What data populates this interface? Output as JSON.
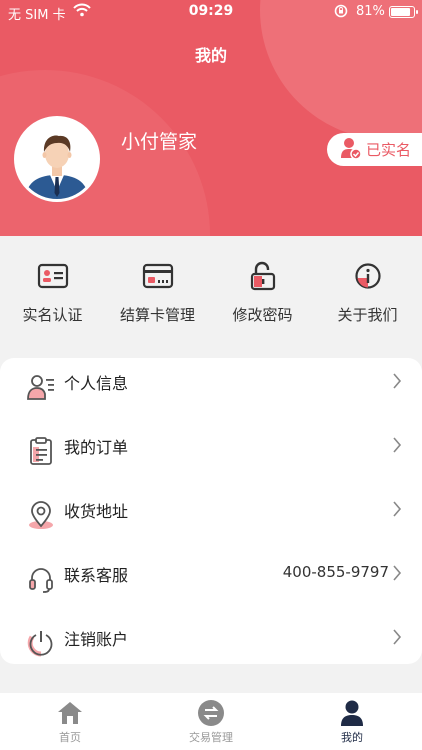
{
  "status_bar": {
    "carrier": "无 SIM 卡",
    "time": "09:29",
    "battery": "81%"
  },
  "nav": {
    "title": "我的"
  },
  "profile": {
    "name": "小付管家",
    "verified_label": "已实名"
  },
  "quick_actions": [
    {
      "label": "实名认证",
      "icon": "id-card-icon"
    },
    {
      "label": "结算卡管理",
      "icon": "bank-card-icon"
    },
    {
      "label": "修改密码",
      "icon": "unlock-icon"
    },
    {
      "label": "关于我们",
      "icon": "info-icon"
    }
  ],
  "menu": [
    {
      "label": "个人信息",
      "icon": "user-info-icon"
    },
    {
      "label": "我的订单",
      "icon": "order-clipboard-icon"
    },
    {
      "label": "收货地址",
      "icon": "location-pin-icon"
    },
    {
      "label": "联系客服",
      "icon": "headset-icon",
      "value": "400-855-9797"
    },
    {
      "label": "注销账户",
      "icon": "power-icon"
    }
  ],
  "tabbar": [
    {
      "label": "首页",
      "icon": "home-icon"
    },
    {
      "label": "交易管理",
      "icon": "exchange-icon"
    },
    {
      "label": "我的",
      "icon": "profile-icon",
      "active": true
    }
  ],
  "colors": {
    "accent": "#ea5a64",
    "tab_active": "#1f2b46",
    "tab_inactive": "#999999"
  }
}
